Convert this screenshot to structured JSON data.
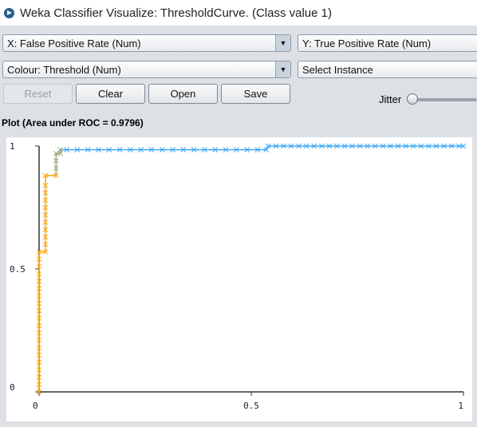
{
  "window": {
    "title": "Weka Classifier Visualize: ThresholdCurve. (Class value 1)"
  },
  "controls": {
    "x_axis": "X: False Positive Rate (Num)",
    "y_axis": "Y: True Positive Rate (Num)",
    "colour": "Colour: Threshold (Num)",
    "select_instance": "Select Instance",
    "reset": "Reset",
    "clear": "Clear",
    "open": "Open",
    "save": "Save",
    "jitter": "Jitter",
    "jitter_value": 0
  },
  "plot_label": "Plot (Area under ROC = 0.9796)",
  "chart_data": {
    "type": "scatter",
    "xlabel": "False Positive Rate",
    "ylabel": "True Positive Rate",
    "xlim": [
      0,
      1
    ],
    "ylim": [
      0,
      1
    ],
    "x_ticks": [
      "0",
      "0.5",
      "1"
    ],
    "y_ticks": [
      "0",
      "0.5",
      "1"
    ],
    "colour_low": "#3fa9f5",
    "colour_high": "#ffa500",
    "points": [
      [
        0,
        0
      ],
      [
        0,
        0.03
      ],
      [
        0,
        0.06
      ],
      [
        0,
        0.09
      ],
      [
        0,
        0.12
      ],
      [
        0,
        0.15
      ],
      [
        0,
        0.18
      ],
      [
        0,
        0.21
      ],
      [
        0,
        0.24
      ],
      [
        0,
        0.27
      ],
      [
        0,
        0.3
      ],
      [
        0,
        0.33
      ],
      [
        0,
        0.36
      ],
      [
        0,
        0.39
      ],
      [
        0,
        0.42
      ],
      [
        0,
        0.45
      ],
      [
        0,
        0.48
      ],
      [
        0,
        0.51
      ],
      [
        0,
        0.54
      ],
      [
        0,
        0.57
      ],
      [
        0.015,
        0.57
      ],
      [
        0.015,
        0.6
      ],
      [
        0.015,
        0.63
      ],
      [
        0.015,
        0.66
      ],
      [
        0.015,
        0.69
      ],
      [
        0.015,
        0.72
      ],
      [
        0.015,
        0.75
      ],
      [
        0.015,
        0.78
      ],
      [
        0.015,
        0.81
      ],
      [
        0.015,
        0.84
      ],
      [
        0.015,
        0.88
      ],
      [
        0.04,
        0.88
      ],
      [
        0.04,
        0.91
      ],
      [
        0.04,
        0.94
      ],
      [
        0.04,
        0.97
      ],
      [
        0.05,
        0.97
      ],
      [
        0.05,
        0.985
      ],
      [
        0.065,
        0.985
      ],
      [
        0.09,
        0.985
      ],
      [
        0.115,
        0.985
      ],
      [
        0.14,
        0.985
      ],
      [
        0.165,
        0.985
      ],
      [
        0.19,
        0.985
      ],
      [
        0.215,
        0.985
      ],
      [
        0.24,
        0.985
      ],
      [
        0.265,
        0.985
      ],
      [
        0.29,
        0.985
      ],
      [
        0.315,
        0.985
      ],
      [
        0.34,
        0.985
      ],
      [
        0.365,
        0.985
      ],
      [
        0.39,
        0.985
      ],
      [
        0.415,
        0.985
      ],
      [
        0.44,
        0.985
      ],
      [
        0.465,
        0.985
      ],
      [
        0.49,
        0.985
      ],
      [
        0.515,
        0.985
      ],
      [
        0.535,
        0.985
      ],
      [
        0.54,
        1
      ],
      [
        0.558,
        1
      ],
      [
        0.576,
        1
      ],
      [
        0.594,
        1
      ],
      [
        0.612,
        1
      ],
      [
        0.63,
        1
      ],
      [
        0.648,
        1
      ],
      [
        0.666,
        1
      ],
      [
        0.684,
        1
      ],
      [
        0.702,
        1
      ],
      [
        0.72,
        1
      ],
      [
        0.738,
        1
      ],
      [
        0.756,
        1
      ],
      [
        0.774,
        1
      ],
      [
        0.792,
        1
      ],
      [
        0.81,
        1
      ],
      [
        0.828,
        1
      ],
      [
        0.846,
        1
      ],
      [
        0.864,
        1
      ],
      [
        0.882,
        1
      ],
      [
        0.9,
        1
      ],
      [
        0.918,
        1
      ],
      [
        0.936,
        1
      ],
      [
        0.954,
        1
      ],
      [
        0.972,
        1
      ],
      [
        0.99,
        1
      ],
      [
        1,
        1
      ]
    ]
  }
}
